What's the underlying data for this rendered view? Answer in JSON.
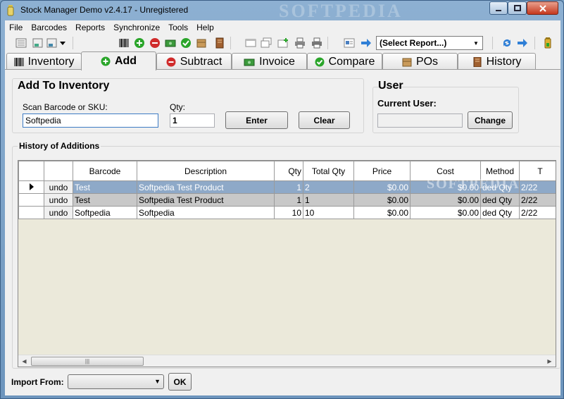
{
  "window": {
    "title": "Stock Manager Demo v2.4.17 - Unregistered",
    "watermark": "SOFTPEDIA"
  },
  "menu": [
    "File",
    "Barcodes",
    "Reports",
    "Synchronize",
    "Tools",
    "Help"
  ],
  "toolbar": {
    "report_select": "(Select Report...)"
  },
  "tabs": [
    {
      "label": "Inventory",
      "icon": "barcode-icon"
    },
    {
      "label": "Add",
      "icon": "plus-circle-icon",
      "active": true
    },
    {
      "label": "Subtract",
      "icon": "minus-circle-icon"
    },
    {
      "label": "Invoice",
      "icon": "money-icon"
    },
    {
      "label": "Compare",
      "icon": "check-circle-icon"
    },
    {
      "label": "POs",
      "icon": "box-icon"
    },
    {
      "label": "History",
      "icon": "book-icon"
    }
  ],
  "add_group": {
    "title": "Add To Inventory",
    "scan_label": "Scan Barcode or SKU:",
    "scan_value": "Softpedia",
    "qty_label": "Qty:",
    "qty_value": "1",
    "enter_button": "Enter",
    "clear_button": "Clear"
  },
  "user_group": {
    "title": "User",
    "current_user_label": "Current User:",
    "current_user_value": "",
    "change_button": "Change"
  },
  "history": {
    "title": "History of Additions",
    "columns": [
      "",
      "",
      "Barcode",
      "Description",
      "Qty",
      "Total Qty",
      "Price",
      "Cost",
      "Method",
      "T"
    ],
    "rows": [
      {
        "undo": "undo",
        "barcode": "Test",
        "description": "Softpedia Test Product",
        "qty": "1",
        "total_qty": "2",
        "price": "$0.00",
        "cost": "$0.00",
        "method": "ded Qty",
        "t": "2/22"
      },
      {
        "undo": "undo",
        "barcode": "Test",
        "description": "Softpedia Test Product",
        "qty": "1",
        "total_qty": "1",
        "price": "$0.00",
        "cost": "$0.00",
        "method": "ded Qty",
        "t": "2/22"
      },
      {
        "undo": "undo",
        "barcode": "Softpedia",
        "description": "Softpedia",
        "qty": "10",
        "total_qty": "10",
        "price": "$0.00",
        "cost": "$0.00",
        "method": "ded Qty",
        "t": "2/22"
      }
    ],
    "grid_watermark": "SOFTPEDIA"
  },
  "import": {
    "label": "Import From:",
    "value": "",
    "ok_button": "OK"
  },
  "colors": {
    "accent_green": "#2aa52a",
    "accent_red": "#d02b2b",
    "selection": "#8ea9c8"
  }
}
